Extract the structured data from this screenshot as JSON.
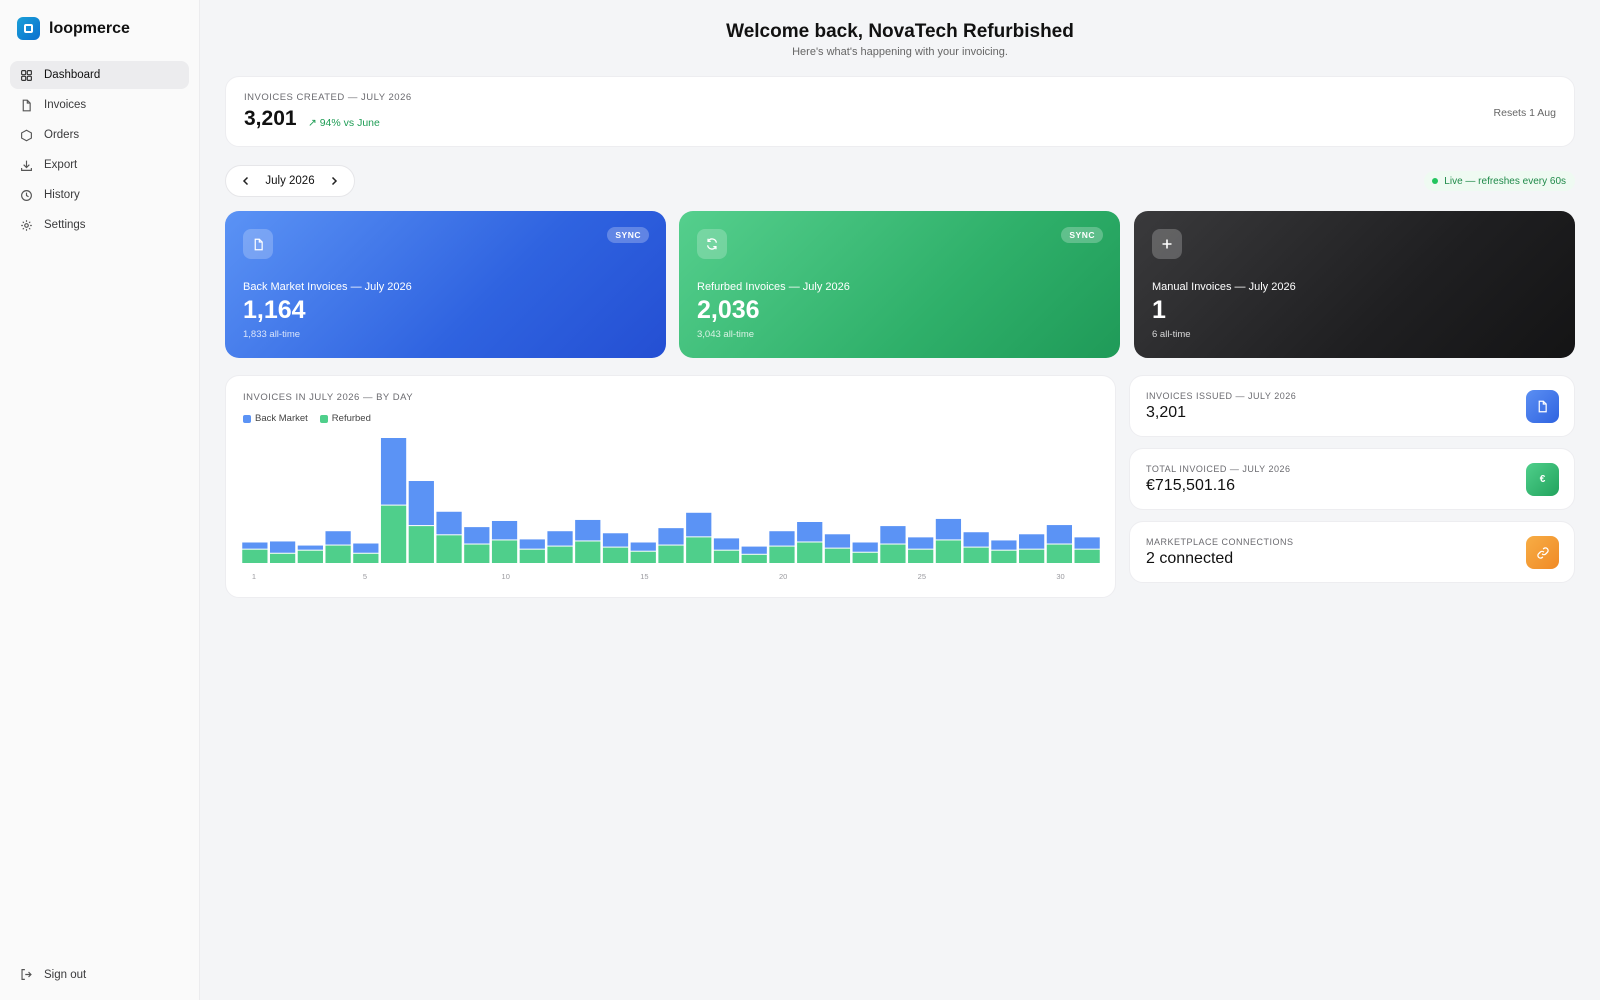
{
  "app": {
    "name": "loopmerce"
  },
  "sidebar": {
    "items": [
      {
        "label": "Dashboard",
        "icon": "grid-icon",
        "active": true
      },
      {
        "label": "Invoices",
        "icon": "file-icon"
      },
      {
        "label": "Orders",
        "icon": "box-icon"
      },
      {
        "label": "Export",
        "icon": "download-icon"
      },
      {
        "label": "History",
        "icon": "clock-icon"
      },
      {
        "label": "Settings",
        "icon": "gear-icon"
      }
    ],
    "signout_label": "Sign out"
  },
  "header": {
    "title": "Welcome back, NovaTech Refurbished",
    "subtitle": "Here's what's happening with your invoicing."
  },
  "summary": {
    "label": "INVOICES CREATED — JULY 2026",
    "value": "3,201",
    "trend": "↗ 94% vs June",
    "trend_color": "#1f9d55",
    "reset": "Resets 1 Aug"
  },
  "period": {
    "label": "July 2026"
  },
  "live": {
    "label": "Live — refreshes every 60s"
  },
  "sources": [
    {
      "title": "Back Market Invoices — July 2026",
      "value": "1,164",
      "sub": "1,833 all-time",
      "badge": "SYNC",
      "icon": "file-icon",
      "color": "#2f63e0"
    },
    {
      "title": "Refurbed Invoices — July 2026",
      "value": "2,036",
      "sub": "3,043 all-time",
      "badge": "SYNC",
      "icon": "refresh-icon",
      "color": "#2fb06a"
    },
    {
      "title": "Manual Invoices — July 2026",
      "value": "1",
      "sub": "6 all-time",
      "icon": "plus-icon",
      "color": "#1f1f21"
    }
  ],
  "stats": [
    {
      "label": "INVOICES ISSUED — JULY 2026",
      "value": "3,201",
      "icon": "file-icon",
      "color": "#3b6fe6"
    },
    {
      "label": "TOTAL INVOICED — JULY 2026",
      "value": "€715,501.16",
      "icon": "euro-icon",
      "icon_text": "€",
      "color": "#2fb06a"
    },
    {
      "label": "MARKETPLACE CONNECTIONS",
      "value": "2 connected",
      "icon": "link-icon",
      "color": "#f39a2c"
    }
  ],
  "chart_data": {
    "type": "bar",
    "stacked": true,
    "title": "INVOICES IN JULY 2026 — BY DAY",
    "x": [
      1,
      2,
      3,
      4,
      5,
      6,
      7,
      8,
      9,
      10,
      11,
      12,
      13,
      14,
      15,
      16,
      17,
      18,
      19,
      20,
      21,
      22,
      23,
      24,
      25,
      26,
      27,
      28,
      29,
      30,
      31
    ],
    "tick_labels": [
      "1",
      "5",
      "10",
      "15",
      "20",
      "25",
      "30"
    ],
    "series": [
      {
        "name": "Back Market",
        "color": "#5b93f5",
        "values": [
          7,
          12,
          5,
          14,
          10,
          66,
          44,
          23,
          17,
          19,
          10,
          15,
          21,
          14,
          9,
          17,
          24,
          12,
          8,
          15,
          20,
          14,
          10,
          18,
          12,
          21,
          15,
          10,
          15,
          19,
          12
        ]
      },
      {
        "name": "Refurbed",
        "color": "#4fcf8b",
        "values": [
          14,
          10,
          13,
          18,
          10,
          57,
          37,
          28,
          19,
          23,
          14,
          17,
          22,
          16,
          12,
          18,
          26,
          13,
          9,
          17,
          21,
          15,
          11,
          19,
          14,
          23,
          16,
          13,
          14,
          19,
          14
        ]
      }
    ],
    "legend": "top-left",
    "grid": false
  }
}
